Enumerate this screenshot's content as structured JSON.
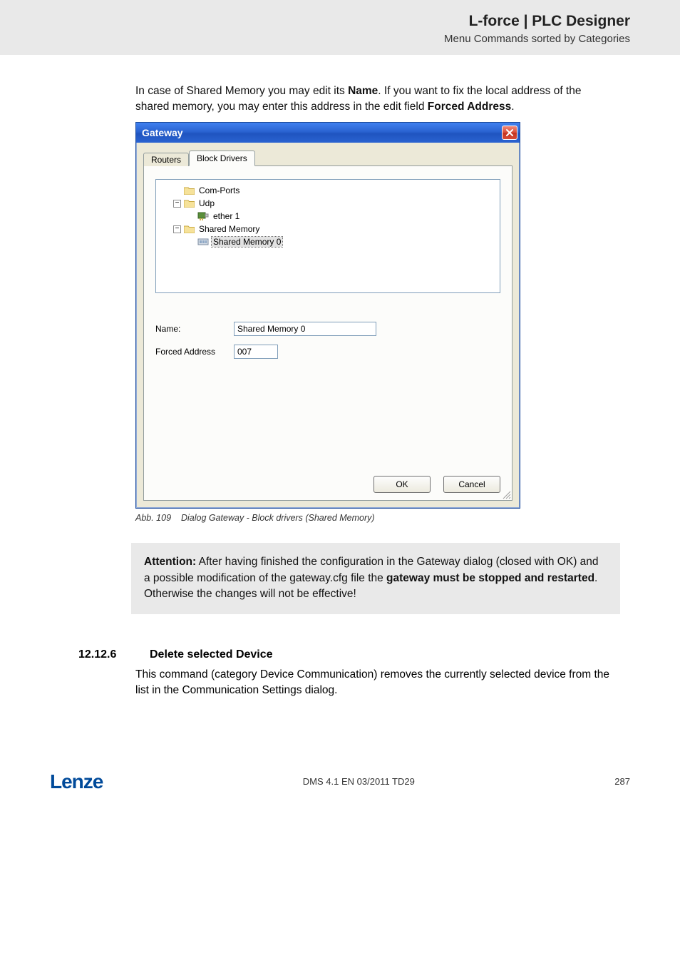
{
  "header": {
    "title": "L-force | PLC Designer",
    "subtitle": "Menu Commands sorted by Categories"
  },
  "intro": {
    "p1_a": "In case of Shared Memory you may edit its ",
    "name_b": "Name",
    "p1_b": ". If you want to fix the local address of the shared memory, you may enter this address in the edit field ",
    "forced_b": "Forced Address",
    "p1_c": "."
  },
  "dialog": {
    "title": "Gateway",
    "tabs": {
      "routers": "Routers",
      "blockDrivers": "Block Drivers"
    },
    "tree": {
      "comPorts": "Com-Ports",
      "udp": "Udp",
      "ether1": "ether 1",
      "sharedMemory": "Shared Memory",
      "sharedMemory0": "Shared Memory 0"
    },
    "form": {
      "nameLabel": "Name:",
      "nameValue": "Shared Memory 0",
      "addrLabel": "Forced Address",
      "addrValue": "007"
    },
    "buttons": {
      "ok": "OK",
      "cancel": "Cancel"
    }
  },
  "figure": {
    "num": "Abb. 109",
    "caption": "Dialog Gateway - Block drivers (Shared Memory)"
  },
  "note": {
    "attention": "Attention:",
    "text1": " After having finished the configuration in the Gateway dialog (closed with OK) and a possible modification of the gateway.cfg file the ",
    "bold2": "gateway must be stopped and restarted",
    "text2": ". Otherwise the changes will not be effective!"
  },
  "section": {
    "num": "12.12.6",
    "title": "Delete selected Device",
    "body": "This command (category Device Communication) removes the currently selected device from the list in the Communication Settings dialog."
  },
  "footer": {
    "logo": "Lenze",
    "center": "DMS 4.1 EN 03/2011 TD29",
    "page": "287"
  }
}
